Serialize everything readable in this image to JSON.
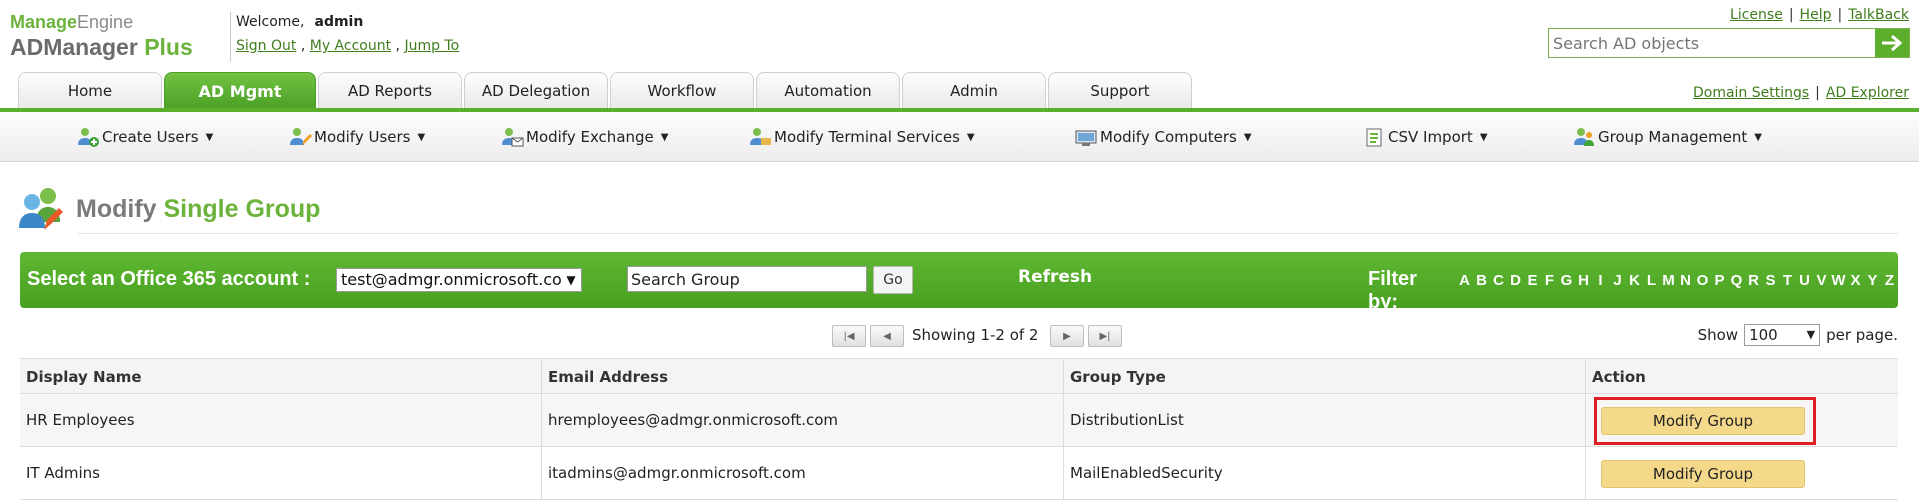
{
  "header": {
    "logo_top_a": "Manage",
    "logo_top_b": "Engine",
    "logo_bot_a": "ADManager",
    "logo_bot_b": " Plus",
    "welcome": "Welcome,",
    "user": "admin",
    "sign_out": "Sign Out",
    "my_account": "My Account",
    "jump_to": "Jump To",
    "link_sep": " , ",
    "license": "License",
    "help": "Help",
    "talkback": "TalkBack",
    "search_placeholder": "Search AD objects",
    "domain_settings": "Domain Settings",
    "ad_explorer": "AD Explorer",
    "pipe": "|"
  },
  "tabs": [
    "Home",
    "AD Mgmt",
    "AD Reports",
    "AD Delegation",
    "Workflow",
    "Automation",
    "Admin",
    "Support"
  ],
  "active_tab": "AD Mgmt",
  "submenu": [
    "Create Users",
    "Modify Users",
    "Modify Exchange",
    "Modify Terminal Services",
    "Modify Computers",
    "CSV Import",
    "Group Management"
  ],
  "page": {
    "title_a": "Modify",
    "title_b": "Single Group"
  },
  "toolbar": {
    "account_label": "Select an Office 365 account :",
    "account_value": "test@admgr.onmicrosoft.com",
    "search_group_value": "Search Group",
    "go": "Go",
    "refresh": "Refresh",
    "filter_label": "Filter by:",
    "letters": [
      "A",
      "B",
      "C",
      "D",
      "E",
      "F",
      "G",
      "H",
      "I",
      "J",
      "K",
      "L",
      "M",
      "N",
      "O",
      "P",
      "Q",
      "R",
      "S",
      "T",
      "U",
      "V",
      "W",
      "X",
      "Y",
      "Z"
    ]
  },
  "pager": {
    "showing": "Showing 1-2 of 2",
    "show": "Show",
    "per_page_value": "100",
    "per_page": "per page."
  },
  "table": {
    "columns": [
      "Display Name",
      "Email Address",
      "Group Type",
      "Action"
    ],
    "rows": [
      {
        "name": "HR Employees",
        "email": "hremployees@admgr.onmicrosoft.com",
        "type": "DistributionList",
        "action": "Modify Group"
      },
      {
        "name": "IT Admins",
        "email": "itadmins@admgr.onmicrosoft.com",
        "type": "MailEnabledSecurity",
        "action": "Modify Group"
      }
    ]
  },
  "colors": {
    "brand_green": "#5cae2d",
    "button_yellow": "#f5d98a",
    "highlight_red": "#e01e25"
  }
}
